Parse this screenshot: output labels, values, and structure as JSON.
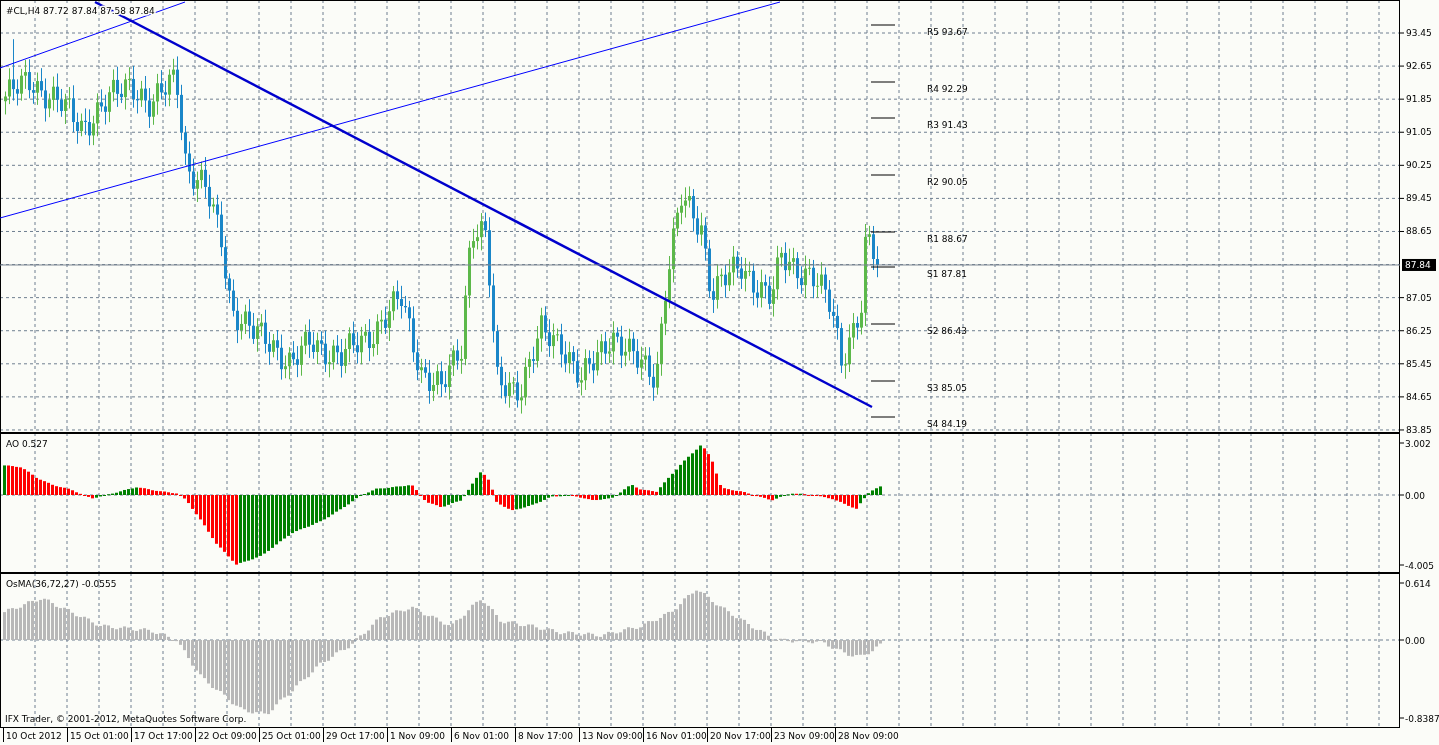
{
  "price_panel": {
    "title": "#CL,H4  87.72 87.84 87.58 87.84",
    "axis_labels": [
      "93.45",
      "92.65",
      "91.85",
      "91.05",
      "90.25",
      "89.45",
      "88.65",
      "87.05",
      "86.25",
      "85.45",
      "84.65",
      "83.85"
    ],
    "current_price": "87.84",
    "pivots": [
      {
        "label": "R5 93.67"
      },
      {
        "label": "R4 92.29"
      },
      {
        "label": "R3 91.43"
      },
      {
        "label": "R2 90.05"
      },
      {
        "label": "R1 88.67"
      },
      {
        "label": "S1 87.81"
      },
      {
        "label": "S2 86.43"
      },
      {
        "label": "S3 85.05"
      },
      {
        "label": "S4 84.19"
      }
    ]
  },
  "indicators": [
    {
      "kind": "ao",
      "title": "AO 0.527",
      "axis_labels": [
        "3.002",
        "0.00",
        "-4.005"
      ]
    },
    {
      "kind": "osma",
      "title": "OsMA(36,72,27) -0.0555",
      "axis_labels": [
        "0.614",
        "0.00",
        "-0.8387"
      ],
      "footer": "IFX Trader, © 2001-2012, MetaQuotes Software Corp."
    }
  ],
  "time_axis": [
    "10 Oct 2012",
    "15 Oct 01:00",
    "17 Oct 17:00",
    "22 Oct 09:00",
    "25 Oct 01:00",
    "29 Oct 17:00",
    "1 Nov 09:00",
    "6 Nov 01:00",
    "8 Nov 17:00",
    "13 Nov 09:00",
    "16 Nov 01:00",
    "20 Nov 17:00",
    "23 Nov 09:00",
    "28 Nov 09:00"
  ]
}
